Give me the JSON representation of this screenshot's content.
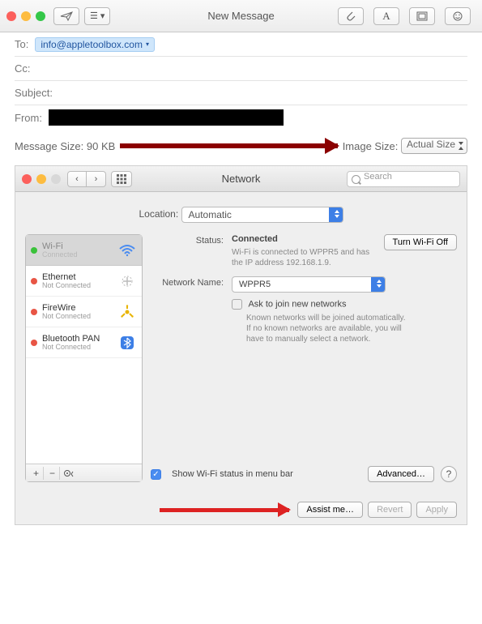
{
  "mail": {
    "title": "New Message",
    "to_label": "To:",
    "to_token": "info@appletoolbox.com",
    "cc_label": "Cc:",
    "subject_label": "Subject:",
    "from_label": "From:",
    "msg_size_label": "Message Size:",
    "msg_size_value": "90 KB",
    "image_size_label": "Image Size:",
    "image_size_value": "Actual Size"
  },
  "network": {
    "title": "Network",
    "search_placeholder": "Search",
    "location_label": "Location:",
    "location_value": "Automatic",
    "services": [
      {
        "name": "Wi-Fi",
        "sub": "Connected",
        "status": "green",
        "sel": true
      },
      {
        "name": "Ethernet",
        "sub": "Not Connected",
        "status": "red"
      },
      {
        "name": "FireWire",
        "sub": "Not Connected",
        "status": "red"
      },
      {
        "name": "Bluetooth PAN",
        "sub": "Not Connected",
        "status": "red"
      }
    ],
    "status_label": "Status:",
    "status_value": "Connected",
    "turnoff": "Turn Wi-Fi Off",
    "status_info": "Wi-Fi is connected to WPPR5 and has the IP address 192.168.1.9.",
    "network_name_label": "Network Name:",
    "network_name_value": "WPPR5",
    "ask_join": "Ask to join new networks",
    "ask_info": "Known networks will be joined automatically. If no known networks are available, you will have to manually select a network.",
    "show_status": "Show Wi-Fi status in menu bar",
    "advanced": "Advanced…",
    "assist": "Assist me…",
    "revert": "Revert",
    "apply": "Apply"
  }
}
